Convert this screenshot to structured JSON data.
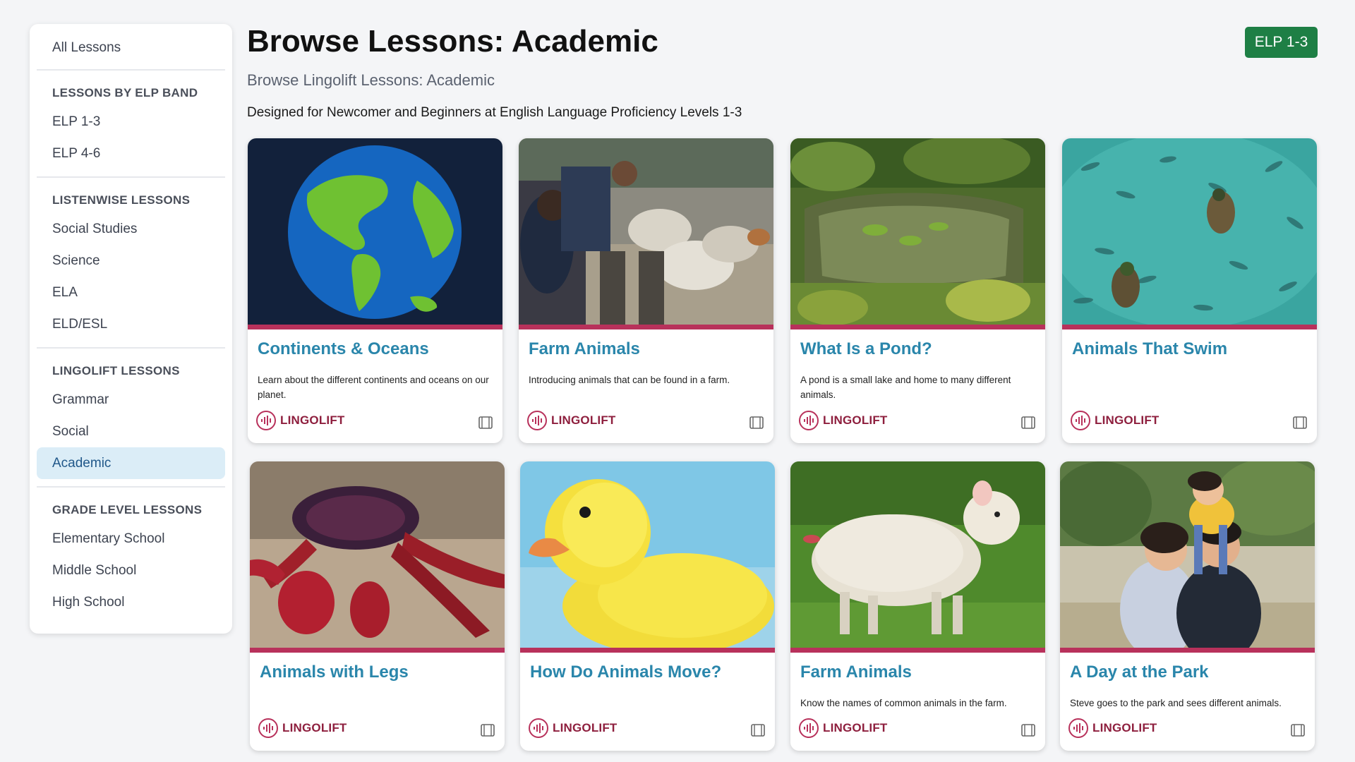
{
  "sidebar": {
    "all_lessons": "All Lessons",
    "sections": [
      {
        "heading": "LESSONS BY ELP BAND",
        "items": [
          "ELP 1-3",
          "ELP 4-6"
        ]
      },
      {
        "heading": "LISTENWISE LESSONS",
        "items": [
          "Social Studies",
          "Science",
          "ELA",
          "ELD/ESL"
        ]
      },
      {
        "heading": "LINGOLIFT LESSONS",
        "items": [
          "Grammar",
          "Social",
          "Academic"
        ]
      },
      {
        "heading": "GRADE LEVEL LESSONS",
        "items": [
          "Elementary School",
          "Middle School",
          "High School"
        ]
      }
    ],
    "active_item": "Academic"
  },
  "header": {
    "title": "Browse Lessons: Academic",
    "subtitle": "Browse Lingolift Lessons: Academic",
    "description": "Designed for Newcomer and Beginners at English Language Proficiency Levels 1-3",
    "badge": "ELP 1-3"
  },
  "colors": {
    "accent_bar": "#b8315b",
    "card_title": "#2a86ab",
    "badge_bg": "#1e7f45",
    "active_bg": "#dbedf7"
  },
  "cards": [
    {
      "title": "Continents & Oceans",
      "description": "Learn about the different continents and oceans on our planet.",
      "brand": "LINGOLIFT",
      "image": "globe-image",
      "media_icon": "film-icon"
    },
    {
      "title": "Farm Animals",
      "description": "Introducing animals that can be found in a farm.",
      "brand": "LINGOLIFT",
      "image": "farm-people-sheep-image",
      "media_icon": "film-icon"
    },
    {
      "title": "What Is a Pond?",
      "description": "A pond is a small lake and home to many different animals.",
      "brand": "LINGOLIFT",
      "image": "pond-image",
      "media_icon": "film-icon"
    },
    {
      "title": "Animals That Swim",
      "description": "",
      "brand": "LINGOLIFT",
      "image": "ducks-fish-water-image",
      "media_icon": "film-icon"
    },
    {
      "title": "Animals with Legs",
      "description": "",
      "brand": "LINGOLIFT",
      "image": "crab-image",
      "media_icon": "film-icon"
    },
    {
      "title": "How Do Animals Move?",
      "description": "",
      "brand": "LINGOLIFT",
      "image": "duckling-image",
      "media_icon": "film-icon"
    },
    {
      "title": "Farm Animals",
      "description": "Know the names of common animals in the farm.",
      "brand": "LINGOLIFT",
      "image": "sheep-image",
      "media_icon": "film-icon"
    },
    {
      "title": "A Day at the Park",
      "description": "Steve goes to the park and sees different animals.",
      "brand": "LINGOLIFT",
      "image": "family-park-image",
      "media_icon": "film-icon"
    }
  ]
}
